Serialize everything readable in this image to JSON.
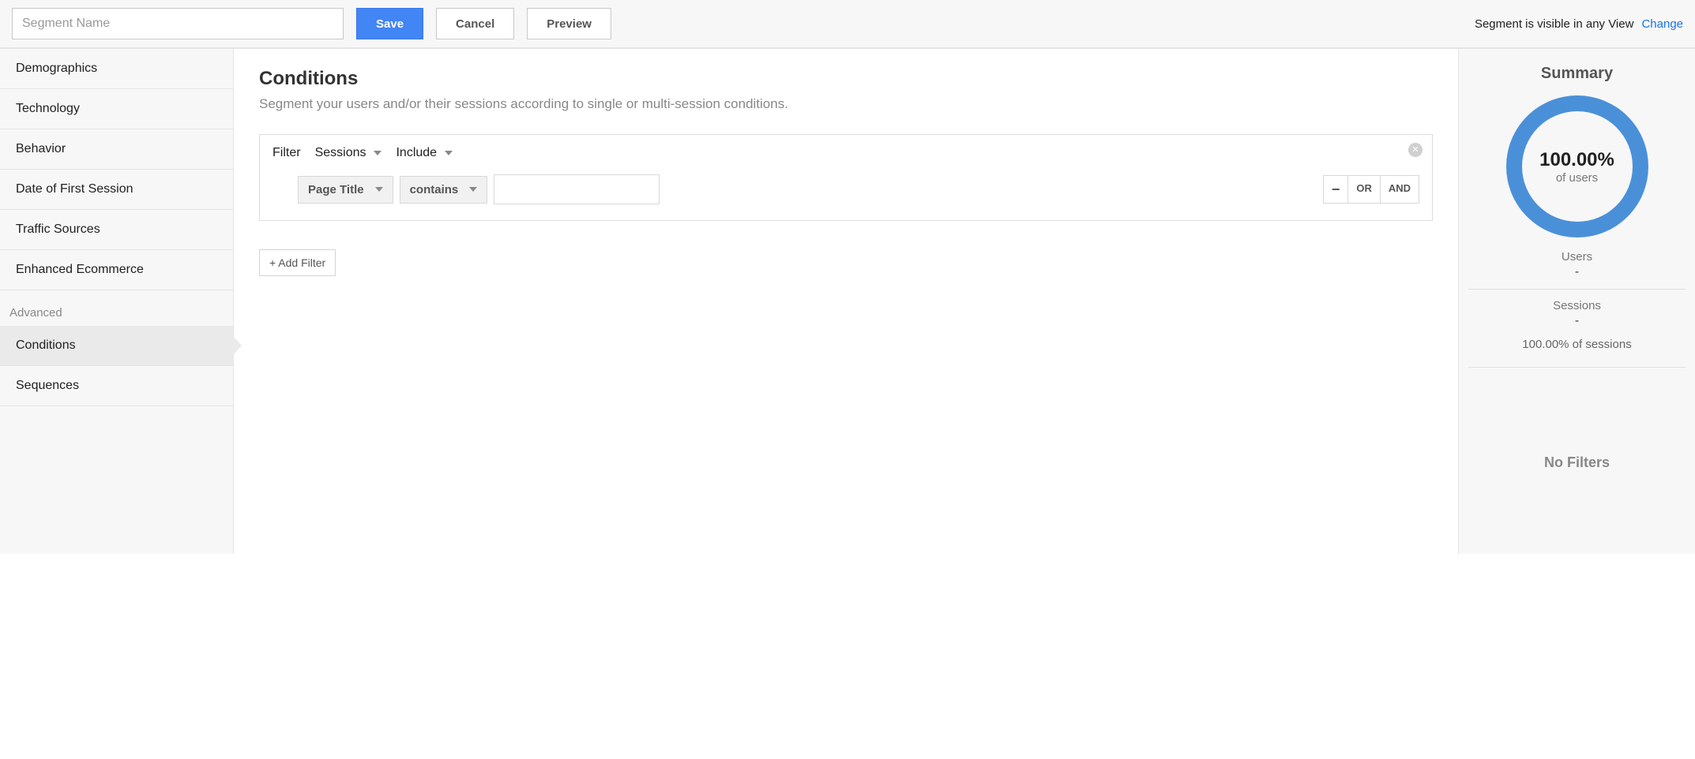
{
  "header": {
    "segment_name_placeholder": "Segment Name",
    "save_label": "Save",
    "cancel_label": "Cancel",
    "preview_label": "Preview",
    "visibility_text": "Segment is visible in any View",
    "change_link": "Change"
  },
  "sidebar": {
    "items": [
      "Demographics",
      "Technology",
      "Behavior",
      "Date of First Session",
      "Traffic Sources",
      "Enhanced Ecommerce"
    ],
    "advanced_label": "Advanced",
    "advanced_items": [
      "Conditions",
      "Sequences"
    ],
    "active": "Conditions"
  },
  "content": {
    "title": "Conditions",
    "subtitle": "Segment your users and/or their sessions according to single or multi-session conditions.",
    "filter_label": "Filter",
    "scope_value": "Sessions",
    "include_value": "Include",
    "dimension_value": "Page Title",
    "match_value": "contains",
    "value_input": "",
    "or_label": "OR",
    "and_label": "AND",
    "remove_label": "−",
    "add_filter_label": "+ Add Filter"
  },
  "summary": {
    "title": "Summary",
    "donut_pct": "100.00%",
    "donut_sub": "of users",
    "users_label": "Users",
    "users_value": "-",
    "sessions_label": "Sessions",
    "sessions_value": "-",
    "sessions_pct": "100.00% of sessions",
    "no_filters": "No Filters"
  }
}
